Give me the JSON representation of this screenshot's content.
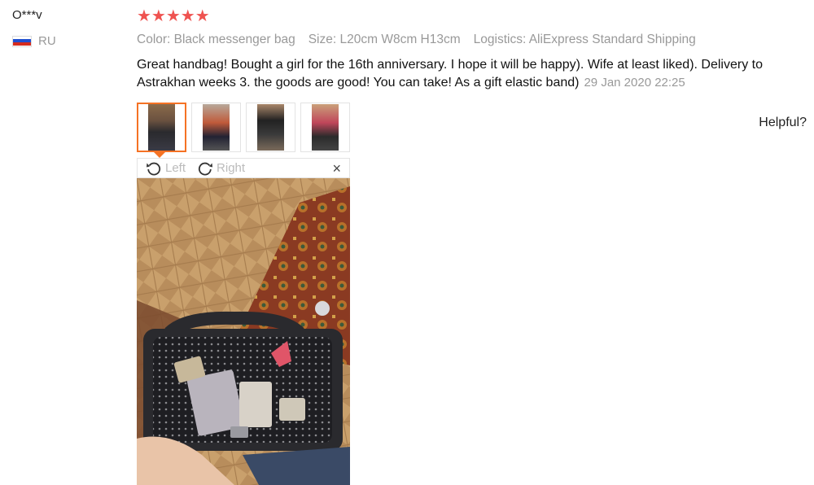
{
  "review": {
    "user_name": "O***v",
    "country_code": "RU",
    "rating": "★★★★★",
    "color_label": "Color: Black messenger bag",
    "size_label": "Size: L20cm W8cm H13cm",
    "logistics_label": "Logistics: AliExpress Standard Shipping",
    "text": "Great handbag! Bought a girl for the 16th anniversary. I hope it will be happy). Wife at least liked). Delivery to Astrakhan weeks 3. the goods are good! You can take! As a gift elastic band)",
    "date": "29 Jan 2020 22:25",
    "helpful_label": "Helpful?"
  },
  "viewer": {
    "rotate_left_label": "Left",
    "rotate_right_label": "Right",
    "close_symbol": "×"
  },
  "colors": {
    "star": "#ef5350",
    "active_thumb_border": "#f57224",
    "muted_text": "#999999"
  },
  "icons": [
    "rotate-left-icon",
    "rotate-right-icon",
    "close-icon",
    "star-icon",
    "russia-flag-icon"
  ]
}
